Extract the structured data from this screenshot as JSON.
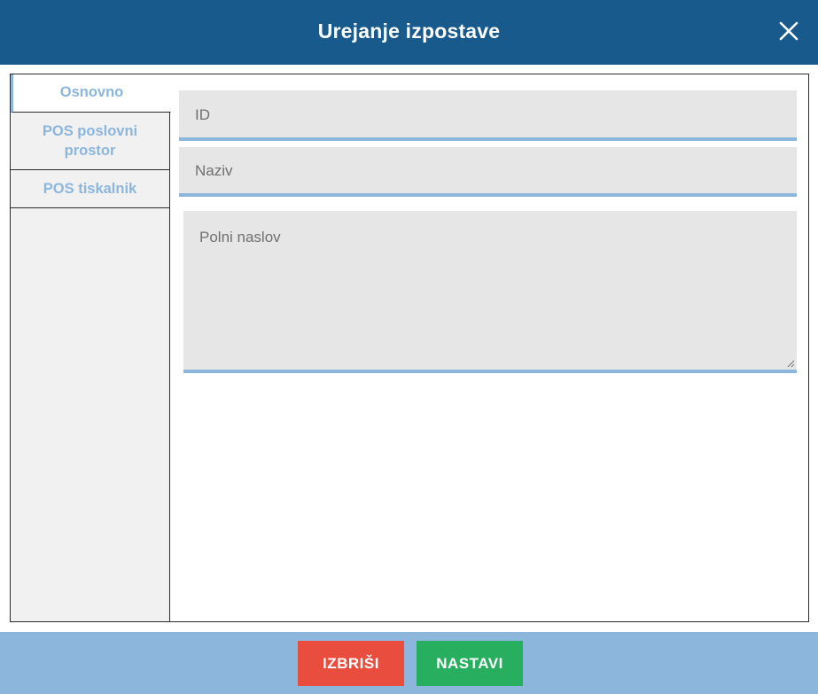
{
  "dialog": {
    "title": "Urejanje izpostave",
    "close_icon": "close-icon"
  },
  "sidebar": {
    "tabs": [
      {
        "label": "Osnovno",
        "active": true
      },
      {
        "label": "POS poslovni prostor",
        "active": false
      },
      {
        "label": "POS tiskalnik",
        "active": false
      }
    ]
  },
  "form": {
    "id": {
      "placeholder": "ID",
      "value": ""
    },
    "naziv": {
      "placeholder": "Naziv",
      "value": ""
    },
    "naslov": {
      "placeholder": "Polni naslov",
      "value": ""
    }
  },
  "footer": {
    "delete_label": "IZBRIŠI",
    "continue_label": "NASTAVI"
  },
  "colors": {
    "titlebar": "#185a8c",
    "accent": "#8cb6dc",
    "delete": "#e94d3d",
    "continue": "#27ae5f"
  }
}
